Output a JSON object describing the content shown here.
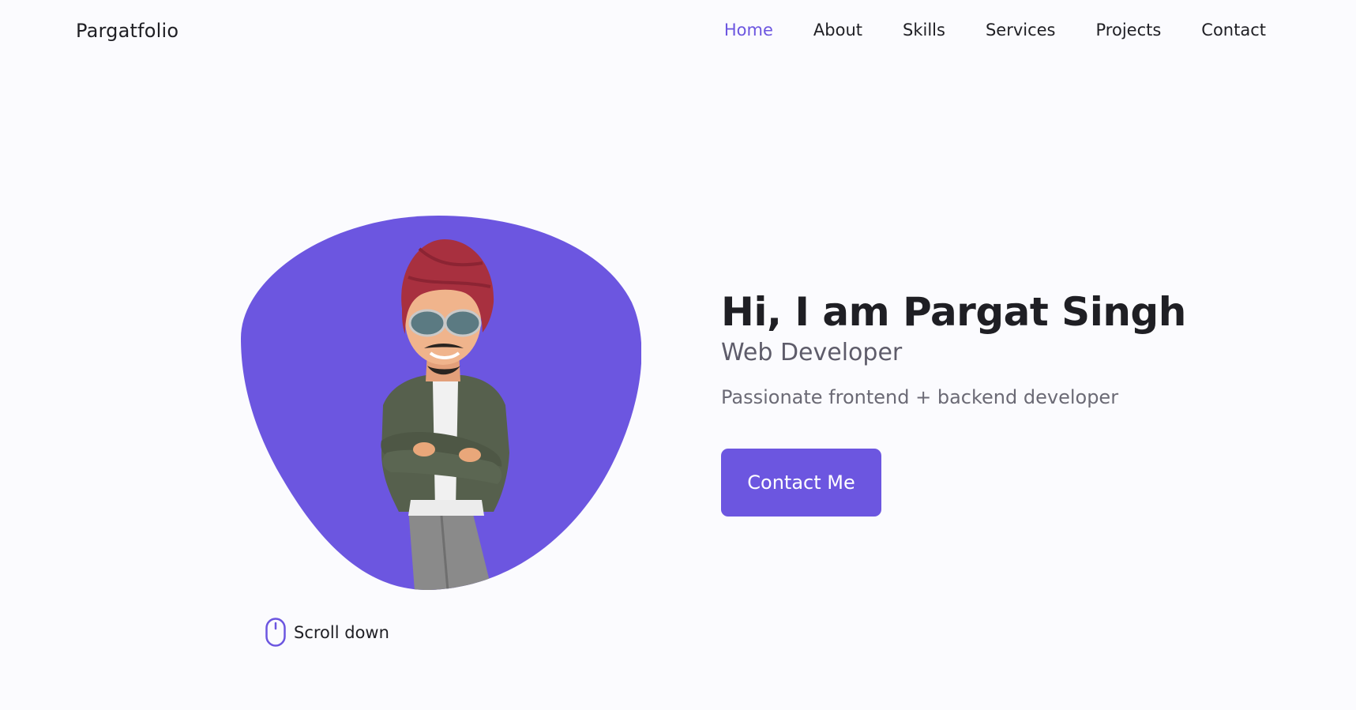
{
  "header": {
    "logo": "Pargatfolio",
    "nav": [
      {
        "label": "Home",
        "active": true
      },
      {
        "label": "About",
        "active": false
      },
      {
        "label": "Skills",
        "active": false
      },
      {
        "label": "Services",
        "active": false
      },
      {
        "label": "Projects",
        "active": false
      },
      {
        "label": "Contact",
        "active": false
      }
    ]
  },
  "hero": {
    "title": "Hi, I am Pargat Singh",
    "subtitle": "Web Developer",
    "description": "Passionate frontend + backend developer",
    "cta_label": "Contact Me",
    "avatar_icon": "memoji-avatar"
  },
  "scroll": {
    "label": "Scroll down",
    "icon": "mouse-icon"
  },
  "colors": {
    "accent": "#6c56e0",
    "background": "#fbfbfe",
    "text": "#1f1f24",
    "muted": "#6b6a75"
  }
}
